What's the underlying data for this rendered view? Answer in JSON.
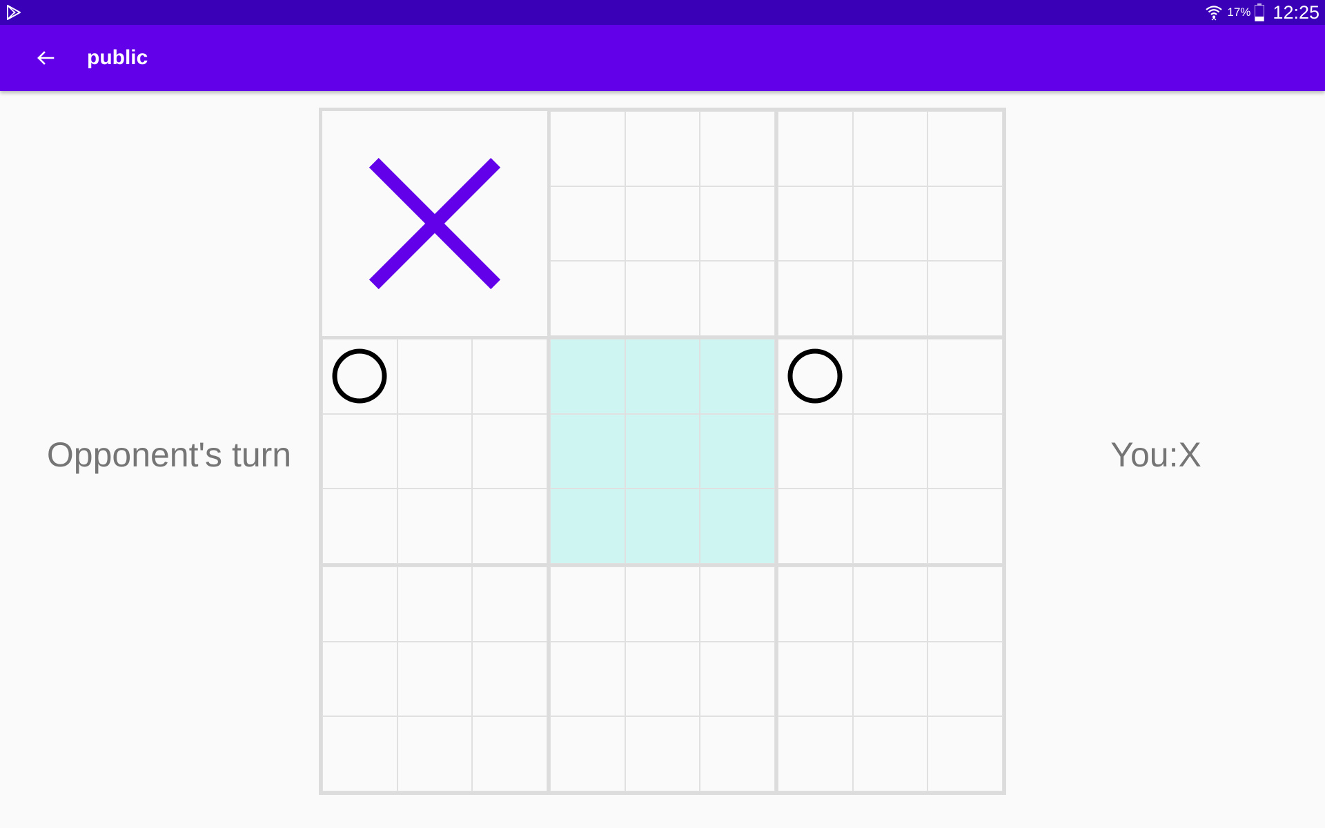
{
  "status_bar": {
    "app_icon": "play-store-icon",
    "wifi_icon": "wifi-icon",
    "battery_percent": "17%",
    "battery_icon": "battery-icon",
    "time": "12:25"
  },
  "app_bar": {
    "back_icon": "arrow-back-icon",
    "title": "public",
    "color": "#6200ea"
  },
  "game": {
    "turn_status": "Opponent's turn",
    "player_mark": "You:X",
    "active_board_color": "#cef5f1",
    "x_color": "#6200ea",
    "o_color": "#000000",
    "active_board": 4,
    "sub_boards": [
      {
        "winner": "X",
        "cells": [
          "",
          "",
          "",
          "",
          "",
          "",
          "",
          "",
          ""
        ]
      },
      {
        "winner": "",
        "cells": [
          "",
          "",
          "",
          "",
          "",
          "",
          "",
          "",
          ""
        ]
      },
      {
        "winner": "",
        "cells": [
          "",
          "",
          "",
          "",
          "",
          "",
          "",
          "",
          ""
        ]
      },
      {
        "winner": "",
        "cells": [
          "O",
          "",
          "",
          "",
          "",
          "",
          "",
          "",
          ""
        ]
      },
      {
        "winner": "",
        "cells": [
          "",
          "",
          "",
          "",
          "",
          "",
          "",
          "",
          ""
        ]
      },
      {
        "winner": "",
        "cells": [
          "O",
          "",
          "",
          "",
          "",
          "",
          "",
          "",
          ""
        ]
      },
      {
        "winner": "",
        "cells": [
          "",
          "",
          "",
          "",
          "",
          "",
          "",
          "",
          ""
        ]
      },
      {
        "winner": "",
        "cells": [
          "",
          "",
          "",
          "",
          "",
          "",
          "",
          "",
          ""
        ]
      },
      {
        "winner": "",
        "cells": [
          "",
          "",
          "",
          "",
          "",
          "",
          "",
          "",
          ""
        ]
      }
    ]
  }
}
